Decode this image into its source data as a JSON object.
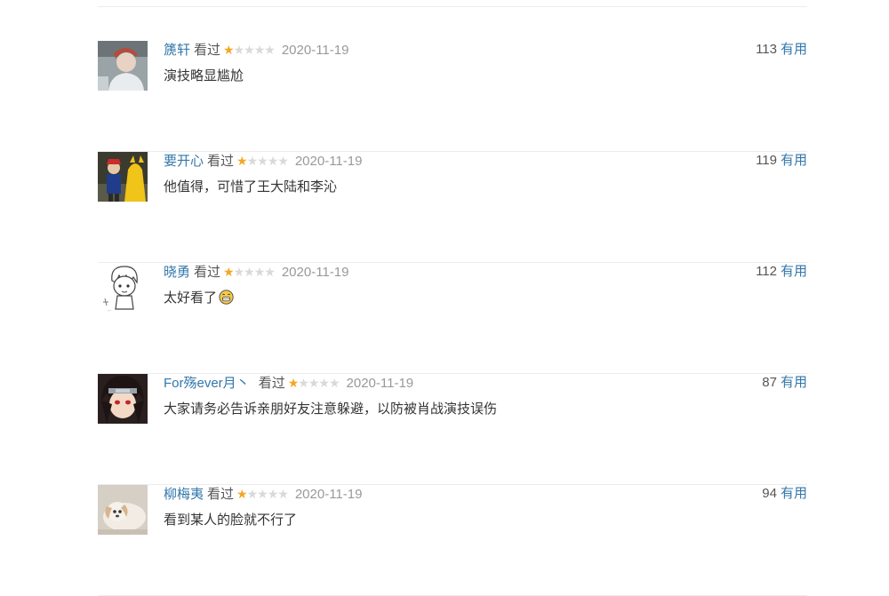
{
  "comments": [
    {
      "user": "篪轩",
      "status": "看过",
      "rating": 1,
      "rating_max": 5,
      "date": "2020-11-19",
      "votes": "113",
      "useful_label": "有用",
      "text": "演技略显尴尬",
      "avatar_icon": "avatar-person-photo"
    },
    {
      "user": "要开心",
      "status": "看过",
      "rating": 1,
      "rating_max": 5,
      "date": "2020-11-19",
      "votes": "119",
      "useful_label": "有用",
      "text": "他值得，可惜了王大陆和李沁",
      "avatar_icon": "avatar-costume-photo"
    },
    {
      "user": "晓勇",
      "status": "看过",
      "rating": 1,
      "rating_max": 5,
      "date": "2020-11-19",
      "votes": "112",
      "useful_label": "有用",
      "text": "太好看了",
      "text_emoji": "grin-emoji",
      "avatar_icon": "avatar-sketch-cartoon"
    },
    {
      "user": "For殇ever月丶",
      "status": "看过",
      "rating": 1,
      "rating_max": 5,
      "date": "2020-11-19",
      "votes": "87",
      "useful_label": "有用",
      "text": "大家请务必告诉亲朋好友注意躲避，以防被肖战演技误伤",
      "avatar_icon": "avatar-anime-character"
    },
    {
      "user": "柳梅夷",
      "status": "看过",
      "rating": 1,
      "rating_max": 5,
      "date": "2020-11-19",
      "votes": "94",
      "useful_label": "有用",
      "text": "看到某人的脸就不行了",
      "avatar_icon": "avatar-dog-photo"
    }
  ],
  "colors": {
    "link": "#3377aa",
    "star_on": "#f5a623",
    "star_off": "#d9d9d9",
    "date": "#999999",
    "divider": "#ececec"
  }
}
